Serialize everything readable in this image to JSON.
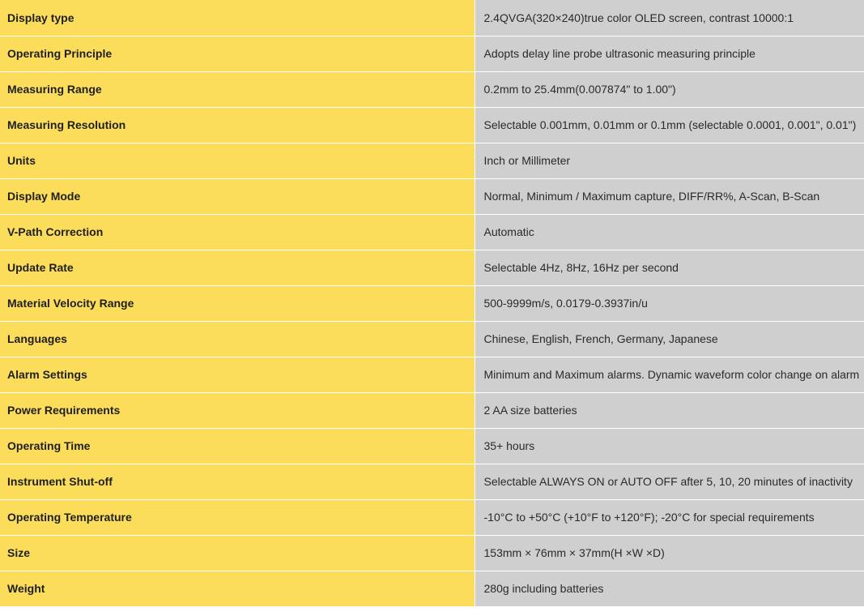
{
  "specs": [
    {
      "label": "Display type",
      "value": "2.4QVGA(320×240)true color OLED screen, contrast 10000:1"
    },
    {
      "label": "Operating Principle",
      "value": "Adopts delay line probe ultrasonic measuring principle"
    },
    {
      "label": "Measuring Range",
      "value": "0.2mm to 25.4mm(0.007874\" to 1.00\")"
    },
    {
      "label": "Measuring Resolution",
      "value": "Selectable 0.001mm, 0.01mm or 0.1mm (selectable 0.0001, 0.001\", 0.01\")"
    },
    {
      "label": "Units",
      "value": "Inch or Millimeter"
    },
    {
      "label": "Display Mode",
      "value": "Normal, Minimum / Maximum capture, DIFF/RR%, A-Scan, B-Scan"
    },
    {
      "label": "V-Path Correction",
      "value": "Automatic"
    },
    {
      "label": "Update Rate",
      "value": "Selectable 4Hz, 8Hz, 16Hz per second"
    },
    {
      "label": "Material Velocity Range",
      "value": "500-9999m/s, 0.0179-0.3937in/u"
    },
    {
      "label": "Languages",
      "value": "Chinese, English, French, Germany, Japanese"
    },
    {
      "label": "Alarm Settings",
      "value": "Minimum and Maximum alarms. Dynamic waveform color change on alarm"
    },
    {
      "label": "Power Requirements",
      "value": "2 AA size batteries"
    },
    {
      "label": "Operating Time",
      "value": "35+ hours"
    },
    {
      "label": "Instrument Shut-off",
      "value": "Selectable ALWAYS ON or AUTO OFF after 5, 10, 20 minutes of inactivity"
    },
    {
      "label": "Operating Temperature",
      "value": "-10°C to +50°C (+10°F to +120°F); -20°C for special requirements"
    },
    {
      "label": "Size",
      "value": "153mm × 76mm × 37mm(H ×W ×D)"
    },
    {
      "label": "Weight",
      "value": "280g including batteries"
    }
  ],
  "colors": {
    "label_bg": "#fcdd5b",
    "value_bg": "#cfcfcf"
  }
}
